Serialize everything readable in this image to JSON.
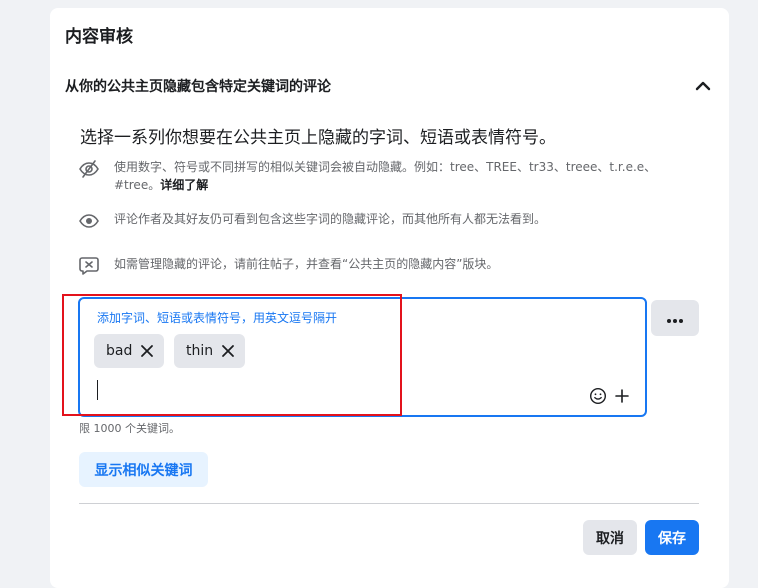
{
  "card": {
    "title": "内容审核"
  },
  "section": {
    "title": "从你的公共主页隐藏包含特定关键词的评论",
    "collapse_icon": "chevron-up-icon"
  },
  "lead": "选择一系列你想要在公共主页上隐藏的字词、短语或表情符号。",
  "info": [
    {
      "icon": "eye-slash-icon",
      "text": "使用数字、符号或不同拼写的相似关键词会被自动隐藏。例如：tree、TREE、tr33、treee、t.r.e.e、#tree。",
      "link": "详细了解"
    },
    {
      "icon": "eye-icon",
      "text": "评论作者及其好友仍可看到包含这些字词的隐藏评论，而其他所有人都无法看到。"
    },
    {
      "icon": "comment-x-icon",
      "text": "如需管理隐藏的评论，请前往帖子，并查看“公共主页的隐藏内容”版块。"
    }
  ],
  "keyword_input": {
    "label": "添加字词、短语或表情符号，用英文逗号隔开",
    "chips": [
      "bad",
      "thin"
    ],
    "value": ""
  },
  "limit_text": "限 1000 个关键词。",
  "similar_button": "显示相似关键词",
  "buttons": {
    "cancel": "取消",
    "save": "保存"
  },
  "colors": {
    "accent": "#1877f2",
    "annotation": "#e3121c"
  }
}
